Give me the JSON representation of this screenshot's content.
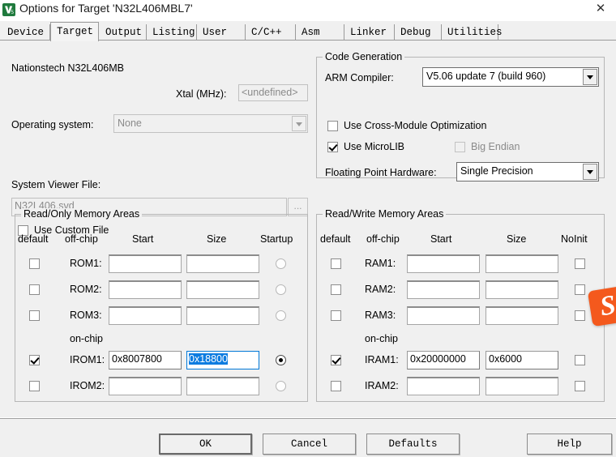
{
  "window": {
    "title": "Options for Target 'N32L406MBL7'",
    "icon": "keil-uvision-icon",
    "close_label": "✕"
  },
  "tabs": [
    {
      "label": "Device",
      "selected": false
    },
    {
      "label": "Target",
      "selected": true
    },
    {
      "label": "Output",
      "selected": false
    },
    {
      "label": "Listing",
      "selected": false
    },
    {
      "label": "User",
      "selected": false
    },
    {
      "label": "C/C++",
      "selected": false
    },
    {
      "label": "Asm",
      "selected": false
    },
    {
      "label": "Linker",
      "selected": false
    },
    {
      "label": "Debug",
      "selected": false
    },
    {
      "label": "Utilities",
      "selected": false
    }
  ],
  "device": {
    "name": "Nationstech N32L406MB",
    "xtal_label": "Xtal (MHz):",
    "xtal_value": "<undefined>",
    "os_label": "Operating system:",
    "os_value": "None",
    "svf_label": "System Viewer File:",
    "svf_value": "N32L406.svd",
    "browse_label": "...",
    "custom_file_label": "Use Custom File",
    "custom_file_checked": false
  },
  "code_generation": {
    "title": "Code Generation",
    "compiler_label": "ARM Compiler:",
    "compiler_value": "V5.06 update 7 (build 960)",
    "cross_module_label": "Use Cross-Module Optimization",
    "cross_module_checked": false,
    "microlib_label": "Use MicroLIB",
    "microlib_checked": true,
    "big_endian_label": "Big Endian",
    "big_endian_checked": false,
    "big_endian_disabled": true,
    "fp_label": "Floating Point Hardware:",
    "fp_value": "Single Precision"
  },
  "readonly_memory": {
    "title": "Read/Only Memory Areas",
    "headers": [
      "default",
      "off-chip",
      "Start",
      "Size",
      "Startup"
    ],
    "onchip_label": "on-chip",
    "rows": [
      {
        "name": "ROM1:",
        "default": false,
        "start": "",
        "size": "",
        "startup": false
      },
      {
        "name": "ROM2:",
        "default": false,
        "start": "",
        "size": "",
        "startup": false
      },
      {
        "name": "ROM3:",
        "default": false,
        "start": "",
        "size": "",
        "startup": false
      },
      {
        "name": "IROM1:",
        "default": true,
        "start": "0x8007800",
        "size": "0x18800",
        "startup": true
      },
      {
        "name": "IROM2:",
        "default": false,
        "start": "",
        "size": "",
        "startup": false
      }
    ]
  },
  "readwrite_memory": {
    "title": "Read/Write Memory Areas",
    "headers": [
      "default",
      "off-chip",
      "Start",
      "Size",
      "NoInit"
    ],
    "onchip_label": "on-chip",
    "rows": [
      {
        "name": "RAM1:",
        "default": false,
        "start": "",
        "size": "",
        "noinit": false
      },
      {
        "name": "RAM2:",
        "default": false,
        "start": "",
        "size": "",
        "noinit": false
      },
      {
        "name": "RAM3:",
        "default": false,
        "start": "",
        "size": "",
        "noinit": false
      },
      {
        "name": "IRAM1:",
        "default": true,
        "start": "0x20000000",
        "size": "0x6000",
        "noinit": false
      },
      {
        "name": "IRAM2:",
        "default": false,
        "start": "",
        "size": "",
        "noinit": false
      }
    ]
  },
  "buttons": {
    "ok": "OK",
    "cancel": "Cancel",
    "defaults": "Defaults",
    "help": "Help"
  },
  "overlay": {
    "sogou_glyph": "S"
  },
  "colors": {
    "dialog_bg": "#f0f0f0",
    "selection_blue": "#0d7ce0",
    "sogou_orange": "#f4591d",
    "border_gray": "#b6b6b6"
  }
}
